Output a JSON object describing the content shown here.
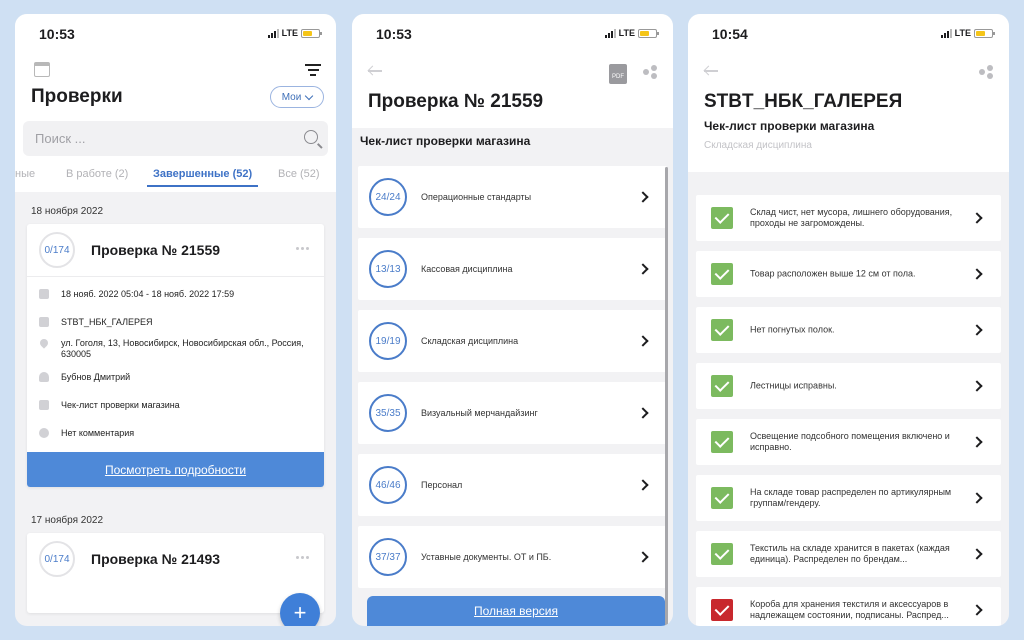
{
  "screen1": {
    "time": "10:53",
    "network": "LTE",
    "title": "Проверки",
    "filter_button": "Мои",
    "search_placeholder": "Поиск ...",
    "tabs": [
      {
        "label": "ные",
        "active": false
      },
      {
        "label": "В работе (2)",
        "active": false
      },
      {
        "label": "Завершенные (52)",
        "active": true
      },
      {
        "label": "Все (52)",
        "active": false
      }
    ],
    "groups": [
      {
        "date": "18 ноября 2022",
        "card": {
          "progress": "0/174",
          "title": "Проверка № 21559",
          "period": "18 нояб. 2022 05:04 - 18 нояб. 2022 17:59",
          "store": "STBT_НБК_ГАЛЕРЕЯ",
          "address": "ул. Гоголя, 13, Новосибирск, Новосибирская обл., Россия, 630005",
          "person": "Бубнов Дмитрий",
          "checklist": "Чек-лист проверки магазина",
          "comment": "Нет комментария",
          "button": "Посмотреть подробности"
        }
      },
      {
        "date": "17 ноября 2022",
        "card": {
          "progress": "0/174",
          "title": "Проверка № 21493"
        }
      }
    ],
    "fab": "+"
  },
  "screen2": {
    "time": "10:53",
    "network": "LTE",
    "pdf_label": "PDF",
    "title": "Проверка № 21559",
    "subtitle": "Чек-лист проверки магазина",
    "categories": [
      {
        "progress": "24/24",
        "label": "Операционные стандарты"
      },
      {
        "progress": "13/13",
        "label": "Кассовая дисциплина"
      },
      {
        "progress": "19/19",
        "label": "Складская дисциплина"
      },
      {
        "progress": "35/35",
        "label": "Визуальный мерчандайзинг"
      },
      {
        "progress": "46/46",
        "label": "Персонал"
      },
      {
        "progress": "37/37",
        "label": "Уставные документы. ОТ и ПБ."
      }
    ],
    "button": "Полная версия"
  },
  "screen3": {
    "time": "10:54",
    "network": "LTE",
    "title": "STBT_НБК_ГАЛЕРЕЯ",
    "subtitle": "Чек-лист проверки магазина",
    "section": "Складская дисциплина",
    "items": [
      {
        "text": "Склад чист, нет мусора, лишнего оборудования, проходы не загромождены.",
        "status": "ok"
      },
      {
        "text": "Товар расположен выше 12 см от пола.",
        "status": "ok"
      },
      {
        "text": "Нет погнутых полок.",
        "status": "ok"
      },
      {
        "text": "Лестницы исправны.",
        "status": "ok"
      },
      {
        "text": "Освещение подсобного помещения включено и исправно.",
        "status": "ok"
      },
      {
        "text": "На складе товар распределен по артикулярным группам/гендеру.",
        "status": "ok"
      },
      {
        "text": "Текстиль на складе хранится в пакетах (каждая единица). Распределен по брендам...",
        "status": "ok"
      },
      {
        "text": "Короба для хранения текстиля и аксессуаров в надлежащем состоянии, подписаны. Распред...",
        "status": "fail"
      }
    ],
    "colors": {
      "ok": "#7cba5f",
      "fail": "#c8282d"
    }
  },
  "colors": {
    "accent": "#4e89d8",
    "background": "#cfe0f3"
  }
}
